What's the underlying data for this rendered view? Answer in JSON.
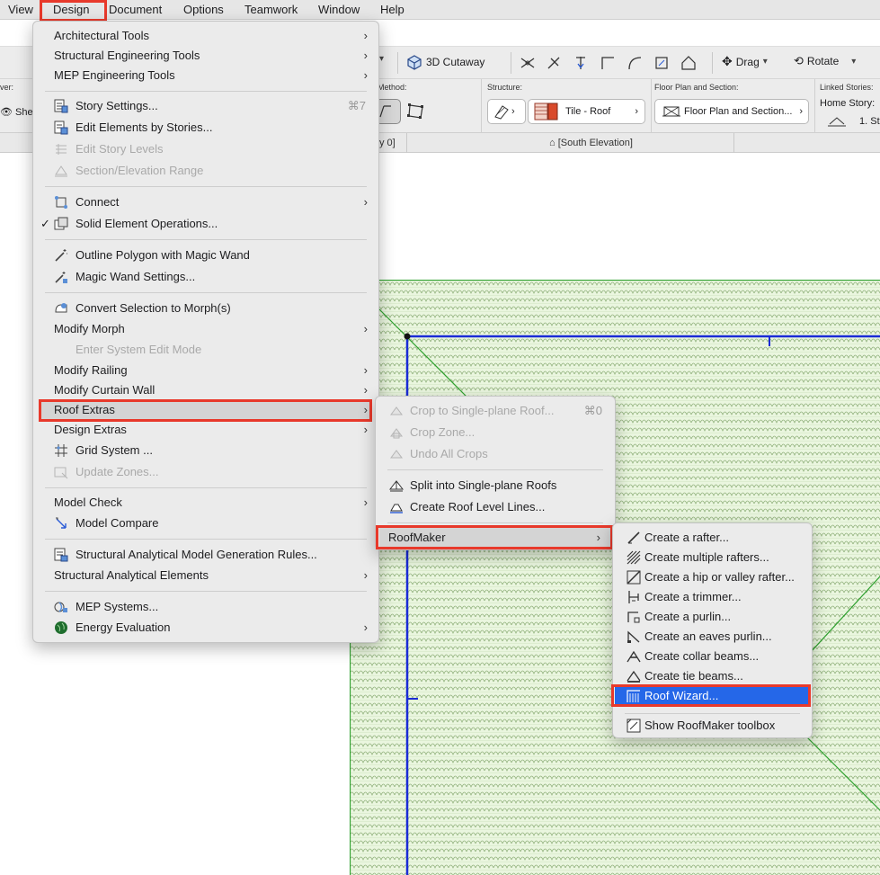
{
  "menubar": {
    "items": [
      "View",
      "Design",
      "Document",
      "Options",
      "Teamwork",
      "Window",
      "Help"
    ],
    "active": "Design"
  },
  "toolbar": {
    "cutaway_label": "3D Cutaway",
    "drag_label": "Drag",
    "rotate_label": "Rotate"
  },
  "infobox": {
    "layer_label": "ver:",
    "layer_value": "She",
    "method_label": "Method:",
    "structure_label": "Structure:",
    "structure_value": "Tile - Roof",
    "floorplan_label": "Floor Plan and Section:",
    "floorplan_value": "Floor Plan and Section...",
    "linked_label": "Linked Stories:",
    "home_story_label": "Home Story:",
    "home_story_value": "1. St"
  },
  "tabs": {
    "story_tab": "y 0]",
    "elevation_tab": "[South Elevation]"
  },
  "design_menu": {
    "items": [
      {
        "label": "Architectural Tools",
        "submenu": true
      },
      {
        "label": "Structural Engineering Tools",
        "submenu": true
      },
      {
        "label": "MEP Engineering Tools",
        "submenu": true
      },
      {
        "label": "Story Settings...",
        "shortcut": "⌘7",
        "icon": "story-settings-icon"
      },
      {
        "label": "Edit Elements by Stories...",
        "icon": "edit-stories-icon"
      },
      {
        "label": "Edit Story Levels",
        "disabled": true,
        "icon": "story-levels-icon"
      },
      {
        "label": "Section/Elevation Range",
        "disabled": true,
        "icon": "section-range-icon"
      },
      {
        "label": "Connect",
        "submenu": true,
        "icon": "connect-icon"
      },
      {
        "label": "Solid Element Operations...",
        "checked": true,
        "icon": "solid-ops-icon"
      },
      {
        "label": "Outline Polygon with Magic Wand",
        "icon": "magic-wand-icon"
      },
      {
        "label": "Magic Wand Settings...",
        "icon": "magic-wand-settings-icon"
      },
      {
        "label": "Convert Selection to Morph(s)",
        "icon": "morph-convert-icon"
      },
      {
        "label": "Modify Morph",
        "submenu": true
      },
      {
        "label": "Enter System Edit Mode",
        "disabled": true
      },
      {
        "label": "Modify Railing",
        "submenu": true
      },
      {
        "label": "Modify Curtain Wall",
        "submenu": true
      },
      {
        "label": "Roof Extras",
        "submenu": true,
        "highlighted": true
      },
      {
        "label": "Design Extras",
        "submenu": true
      },
      {
        "label": "Grid System ...",
        "icon": "grid-system-icon"
      },
      {
        "label": "Update Zones...",
        "disabled": true,
        "icon": "update-zones-icon"
      },
      {
        "label": "Model Check",
        "submenu": true
      },
      {
        "label": "Model Compare",
        "icon": "model-compare-icon"
      },
      {
        "label": "Structural Analytical Model Generation Rules...",
        "icon": "sam-rules-icon"
      },
      {
        "label": "Structural Analytical Elements",
        "submenu": true
      },
      {
        "label": "MEP Systems...",
        "icon": "mep-systems-icon"
      },
      {
        "label": "Energy Evaluation",
        "submenu": true,
        "icon": "energy-globe-icon"
      }
    ]
  },
  "roof_extras_menu": {
    "items": [
      {
        "label": "Crop to Single-plane Roof...",
        "shortcut": "⌘0",
        "disabled": true,
        "icon": "crop-roof-icon"
      },
      {
        "label": "Crop Zone...",
        "disabled": true,
        "icon": "crop-zone-icon"
      },
      {
        "label": "Undo All Crops",
        "disabled": true,
        "icon": "undo-crops-icon"
      },
      {
        "label": "Split into Single-plane Roofs",
        "icon": "split-roof-icon"
      },
      {
        "label": "Create Roof Level Lines...",
        "icon": "roof-level-lines-icon"
      },
      {
        "label": "RoofMaker",
        "submenu": true,
        "highlighted": true
      }
    ]
  },
  "roofmaker_menu": {
    "items": [
      {
        "label": "Create a rafter...",
        "icon": "rafter-icon"
      },
      {
        "label": "Create multiple rafters...",
        "icon": "multi-rafter-icon"
      },
      {
        "label": "Create a hip or valley rafter...",
        "icon": "hip-rafter-icon"
      },
      {
        "label": "Create a trimmer...",
        "icon": "trimmer-icon"
      },
      {
        "label": "Create a purlin...",
        "icon": "purlin-icon"
      },
      {
        "label": "Create an eaves purlin...",
        "icon": "eaves-purlin-icon"
      },
      {
        "label": "Create collar beams...",
        "icon": "collar-beam-icon"
      },
      {
        "label": "Create tie beams...",
        "icon": "tie-beam-icon"
      },
      {
        "label": "Roof Wizard...",
        "icon": "roof-wizard-icon",
        "selected": true
      },
      {
        "label": "Show RoofMaker toolbox",
        "icon": "toolbox-icon"
      }
    ]
  },
  "colors": {
    "highlight_red": "#e8392b",
    "selection_blue": "#2567e8",
    "tile_fill": "#eaf6df",
    "tile_stroke": "#8fb07a",
    "plan_line_blue": "#1a2bd6",
    "ridge_green": "#2fa12f"
  }
}
